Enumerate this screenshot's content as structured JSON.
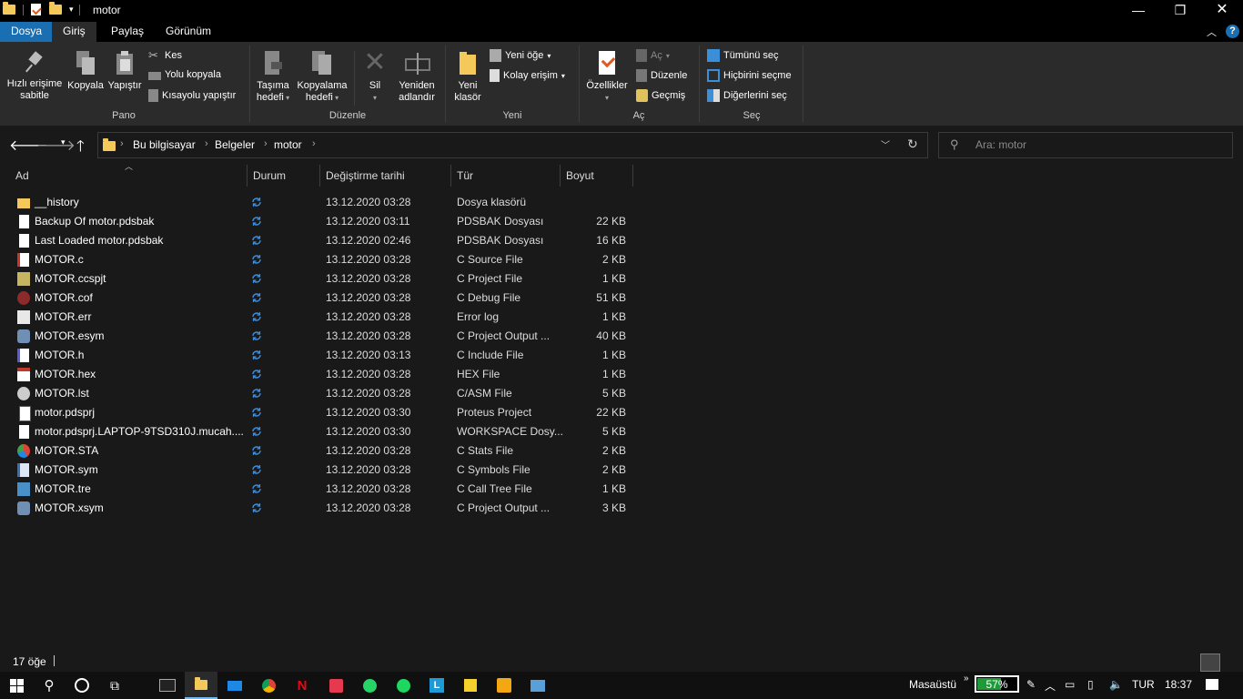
{
  "window": {
    "title": "motor"
  },
  "tabs": [
    "Dosya",
    "Giriş",
    "Paylaş",
    "Görünüm"
  ],
  "ribbon": {
    "pano": {
      "label": "Pano",
      "pin": [
        "Hızlı erişime",
        "sabitle"
      ],
      "copy": "Kopyala",
      "paste": "Yapıştır",
      "cut": "Kes",
      "copy_path": "Yolu kopyala",
      "paste_shortcut": "Kısayolu yapıştır"
    },
    "duzenle": {
      "label": "Düzenle",
      "move_to": [
        "Taşıma",
        "hedefi"
      ],
      "copy_to": [
        "Kopyalama",
        "hedefi"
      ],
      "delete": "Sil",
      "rename": [
        "Yeniden",
        "adlandır"
      ]
    },
    "yeni": {
      "label": "Yeni",
      "new_folder": [
        "Yeni",
        "klasör"
      ],
      "new_item": "Yeni öğe",
      "easy_access": "Kolay erişim"
    },
    "ac": {
      "label": "Aç",
      "properties": "Özellikler",
      "open": "Aç",
      "edit": "Düzenle",
      "history": "Geçmiş"
    },
    "sec": {
      "label": "Seç",
      "select_all": "Tümünü seç",
      "select_none": "Hiçbirini seçme",
      "invert": "Diğerlerini seç"
    }
  },
  "breadcrumb": [
    "Bu bilgisayar",
    "Belgeler",
    "motor"
  ],
  "search": {
    "placeholder": "Ara: motor"
  },
  "columns": {
    "name": "Ad",
    "status": "Durum",
    "modified": "Değiştirme tarihi",
    "type": "Tür",
    "size": "Boyut"
  },
  "files": [
    {
      "name": "__history",
      "date": "13.12.2020 03:28",
      "type": "Dosya klasörü",
      "size": "",
      "icon": "folder-icon"
    },
    {
      "name": "Backup Of motor.pdsbak",
      "date": "13.12.2020 03:11",
      "type": "PDSBAK Dosyası",
      "size": "22 KB",
      "icon": "blank-file-icon"
    },
    {
      "name": "Last Loaded motor.pdsbak",
      "date": "13.12.2020 02:46",
      "type": "PDSBAK Dosyası",
      "size": "16 KB",
      "icon": "blank-file-icon"
    },
    {
      "name": "MOTOR.c",
      "date": "13.12.2020 03:28",
      "type": "C Source File",
      "size": "2 KB",
      "icon": "c-source-icon"
    },
    {
      "name": "MOTOR.ccspjt",
      "date": "13.12.2020 03:28",
      "type": "C Project File",
      "size": "1 KB",
      "icon": "project-icon"
    },
    {
      "name": "MOTOR.cof",
      "date": "13.12.2020 03:28",
      "type": "C Debug File",
      "size": "51 KB",
      "icon": "bug-icon"
    },
    {
      "name": "MOTOR.err",
      "date": "13.12.2020 03:28",
      "type": "Error log",
      "size": "1 KB",
      "icon": "log-icon"
    },
    {
      "name": "MOTOR.esym",
      "date": "13.12.2020 03:28",
      "type": "C Project Output ...",
      "size": "40 KB",
      "icon": "gear-file-icon"
    },
    {
      "name": "MOTOR.h",
      "date": "13.12.2020 03:13",
      "type": "C Include File",
      "size": "1 KB",
      "icon": "header-file-icon"
    },
    {
      "name": "MOTOR.hex",
      "date": "13.12.2020 03:28",
      "type": "HEX File",
      "size": "1 KB",
      "icon": "hex-file-icon"
    },
    {
      "name": "MOTOR.lst",
      "date": "13.12.2020 03:28",
      "type": "C/ASM File",
      "size": "5 KB",
      "icon": "asm-file-icon"
    },
    {
      "name": "motor.pdsprj",
      "date": "13.12.2020 03:30",
      "type": "Proteus Project",
      "size": "22 KB",
      "icon": "proteus-icon"
    },
    {
      "name": "motor.pdsprj.LAPTOP-9TSD310J.mucah....",
      "date": "13.12.2020 03:30",
      "type": "WORKSPACE Dosy...",
      "size": "5 KB",
      "icon": "blank-file-icon"
    },
    {
      "name": "MOTOR.STA",
      "date": "13.12.2020 03:28",
      "type": "C Stats File",
      "size": "2 KB",
      "icon": "stats-icon"
    },
    {
      "name": "MOTOR.sym",
      "date": "13.12.2020 03:28",
      "type": "C Symbols File",
      "size": "2 KB",
      "icon": "symbols-icon"
    },
    {
      "name": "MOTOR.tre",
      "date": "13.12.2020 03:28",
      "type": "C Call Tree File",
      "size": "1 KB",
      "icon": "tree-icon"
    },
    {
      "name": "MOTOR.xsym",
      "date": "13.12.2020 03:28",
      "type": "C Project Output ...",
      "size": "3 KB",
      "icon": "gear-file-icon"
    }
  ],
  "status": {
    "count": "17 öğe"
  },
  "taskbar": {
    "desktop": "Masaüstü",
    "battery": "57%",
    "lang": "TUR",
    "time": "18:37"
  }
}
